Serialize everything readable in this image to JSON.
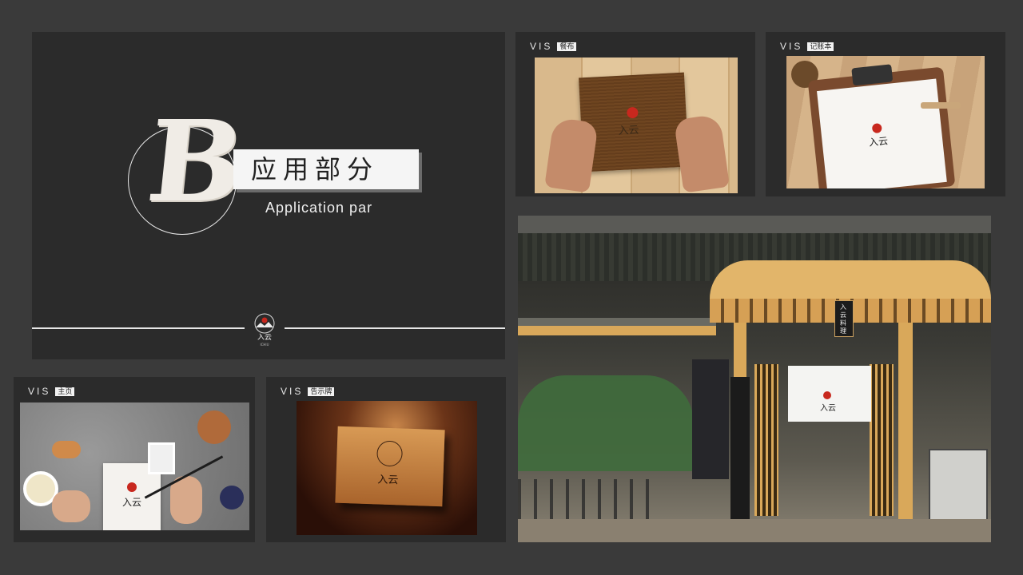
{
  "hero": {
    "letter": "B",
    "title_cn": "应用部分",
    "title_en": "Application par"
  },
  "cards": [
    {
      "prefix": "VIS",
      "label": "餐布"
    },
    {
      "prefix": "VIS",
      "label": "记账本"
    },
    {
      "prefix": "VIS",
      "label": "主页"
    },
    {
      "prefix": "VIS",
      "label": "告示牌"
    }
  ],
  "brand": {
    "name": "入云",
    "sign_text": "入云料理"
  },
  "colors": {
    "background": "#3a3a3a",
    "panel": "#2b2b2b",
    "accent_red": "#c8281e",
    "wood": "#d9b98c"
  }
}
